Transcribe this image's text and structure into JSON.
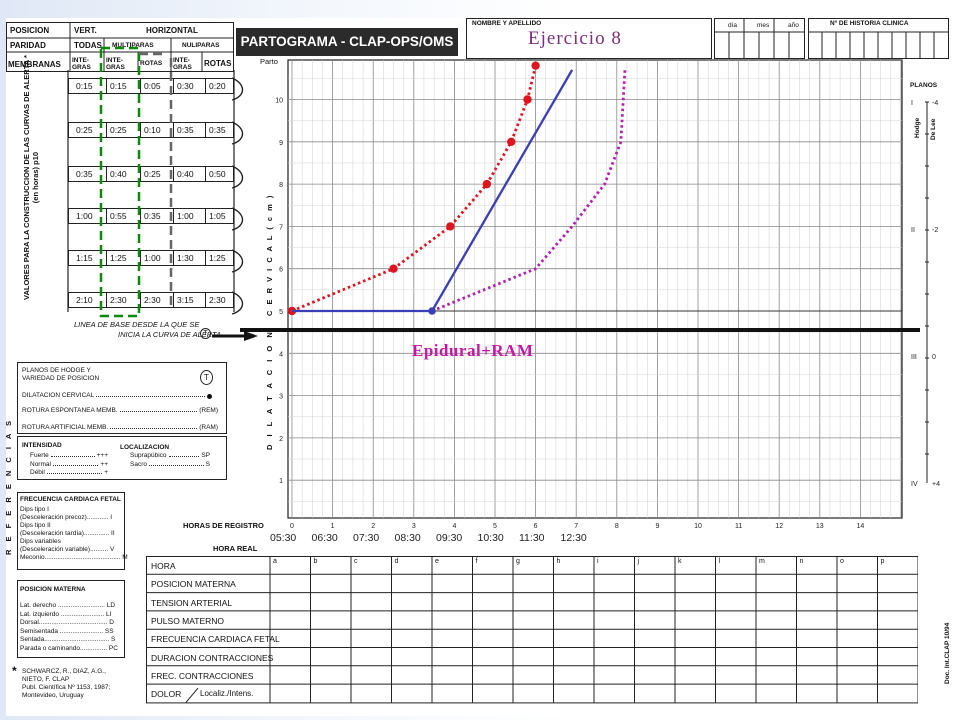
{
  "header": {
    "col_position": "POSICION",
    "col_vert": "VERT.",
    "col_horizontal": "HORIZONTAL",
    "row_paridad": "PARIDAD",
    "todas": "TODAS",
    "multiparas": "MULTIPARAS",
    "nuliparas": "NULIPARAS",
    "row_membranas": "MEMBRANAS",
    "integras": "INTE-GRAS",
    "rotas": "ROTAS",
    "title": "PARTOGRAMA - CLAP-OPS/OMS",
    "nombre": "NOMBRE Y APELLIDO",
    "dia": "día",
    "mes": "mes",
    "ano": "año",
    "historia": "Nº DE HISTORIA CLINICA"
  },
  "exercise_title": "Ejercicio 8",
  "epidural_label": "Epidural+RAM",
  "alert_table": {
    "side_title": "VALORES PARA LA CONSTRUCCION DE LAS CURVAS DE ALERTA *",
    "side_subtitle": "(en horas) p10",
    "rows": [
      [
        "0:15",
        "0:15",
        "0:05",
        "0:30",
        "0:20"
      ],
      [
        "0:25",
        "0:25",
        "0:10",
        "0:35",
        "0:35"
      ],
      [
        "0:35",
        "0:40",
        "0:25",
        "0:40",
        "0:50"
      ],
      [
        "1:00",
        "0:55",
        "0:35",
        "1:00",
        "1:05"
      ],
      [
        "1:15",
        "1:25",
        "1:00",
        "1:30",
        "1:25"
      ],
      [
        "2:10",
        "2:30",
        "2:30",
        "3:15",
        "2:30"
      ]
    ],
    "baseline_note_a": "LINEA DE BASE DESDE LA QUE SE",
    "baseline_note_b": "INICIA LA CURVA DE ALERTA"
  },
  "chart_labels": {
    "parto": "Parto",
    "cervical": "C E R V I C A L   ( c m )",
    "dilatacion": "D I L A T A C I O N",
    "planos": "PLANOS",
    "hodge": "Hodge",
    "delee": "De Lee",
    "planos_rows": [
      {
        "hodge": "I",
        "delee": "-4"
      },
      {
        "hodge": "II",
        "delee": "-2"
      },
      {
        "hodge": "III",
        "delee": "0"
      },
      {
        "hodge": "IV",
        "delee": "+4"
      }
    ],
    "horas_registro": "HORAS DE REGISTRO",
    "hora_real": "HORA REAL"
  },
  "chart_data": {
    "type": "line",
    "xlabel": "HORAS DE REGISTRO",
    "ylabel": "DILATACION CERVICAL (cm)",
    "xlim": [
      0,
      15
    ],
    "ylim": [
      0,
      10
    ],
    "x_ticks": [
      0,
      1,
      2,
      3,
      4,
      5,
      6,
      7,
      8,
      9,
      10,
      11,
      12,
      13,
      14
    ],
    "y_ticks": [
      1,
      2,
      3,
      4,
      5,
      6,
      7,
      8,
      9,
      10
    ],
    "real_hours": [
      "05:30",
      "06:30",
      "07:30",
      "08:30",
      "09:30",
      "10:30",
      "11:30",
      "12:30"
    ],
    "series": [
      {
        "color": "#e0141e",
        "style": "dotted",
        "marker": "dot",
        "x": [
          0,
          2.5,
          3.9,
          4.8,
          5.4,
          5.8,
          6.0
        ],
        "y": [
          5,
          6,
          7,
          8,
          9,
          10,
          10.8
        ]
      },
      {
        "color": "#3b3fb6",
        "style": "solid",
        "x": [
          0,
          3.45,
          6.9
        ],
        "y": [
          5,
          5,
          10.7
        ]
      },
      {
        "color": "#b21fb0",
        "style": "dotted",
        "x": [
          3.45,
          6.0,
          6.9,
          7.7,
          8.1,
          8.2
        ],
        "y": [
          5,
          6,
          7,
          8,
          9,
          10.7
        ]
      }
    ],
    "markers": [
      {
        "color": "#3b3fb6",
        "x": 3.45,
        "y": 5
      }
    ]
  },
  "references": {
    "vertical_label": "R E F E R E N C I A S",
    "planos": "PLANOS DE HODGE Y VARIEDAD DE POSICION",
    "dilatacion": "DILATACION CERVICAL",
    "rotura_esp": "ROTURA ESPONTANEA MEMB.",
    "rem": "(REM)",
    "rotura_art": "ROTURA ARTIFICIAL MEMB.",
    "ram": "(RAM)",
    "intensidad": "INTENSIDAD",
    "fuerte": "Fuerte",
    "fuerte_sym": "+++",
    "normal": "Normal",
    "normal_sym": "++",
    "debil": "Débil",
    "debil_sym": "+",
    "localizacion": "LOCALIZACION",
    "suprapubico": "Suprapúbico",
    "sp": "SP",
    "sacro": "Sacro",
    "s": "S",
    "fcf_title": "FRECUENCIA CARDIACA FETAL",
    "fcf_lines": [
      "Dips tipo I",
      "(Desceleración precoz)............ I",
      "Dips tipo II",
      "(Desceleración tardía).............. II",
      "Dips variables",
      "(Desceleración variable).......... V",
      "Meconio.......................................... M"
    ],
    "posicion_title": "POSICION MATERNA",
    "posicion_lines": [
      "Lat. derecho .......................... LD",
      "Lat. izquierdo ........................ LI",
      "Dorsal...................................... D",
      "Semisentada ........................ SS",
      "Sentada.................................... S",
      "Parada o caminando............... PC"
    ],
    "citation": [
      "SCHWARCZ, R., DIAZ, A.G.,",
      "NIETO, F. CLAP",
      "Publ. Científica Nº 1153, 1987;",
      "Montevideo, Uruguay"
    ],
    "doc": "Doc. Int.CLAP 10/94"
  },
  "bottom_table": {
    "rows": [
      "HORA",
      "POSICION MATERNA",
      "TENSION ARTERIAL",
      "PULSO MATERNO",
      "FRECUENCIA CARDIACA FETAL",
      "DURACION CONTRACCIONES",
      "FREC. CONTRACCIONES",
      "DOLOR"
    ],
    "dolor_sub": "Localiz./Intens.",
    "columns": [
      "a",
      "b",
      "c",
      "d",
      "e",
      "f",
      "g",
      "h",
      "i",
      "j",
      "k",
      "l",
      "m",
      "n",
      "o",
      "p"
    ]
  }
}
